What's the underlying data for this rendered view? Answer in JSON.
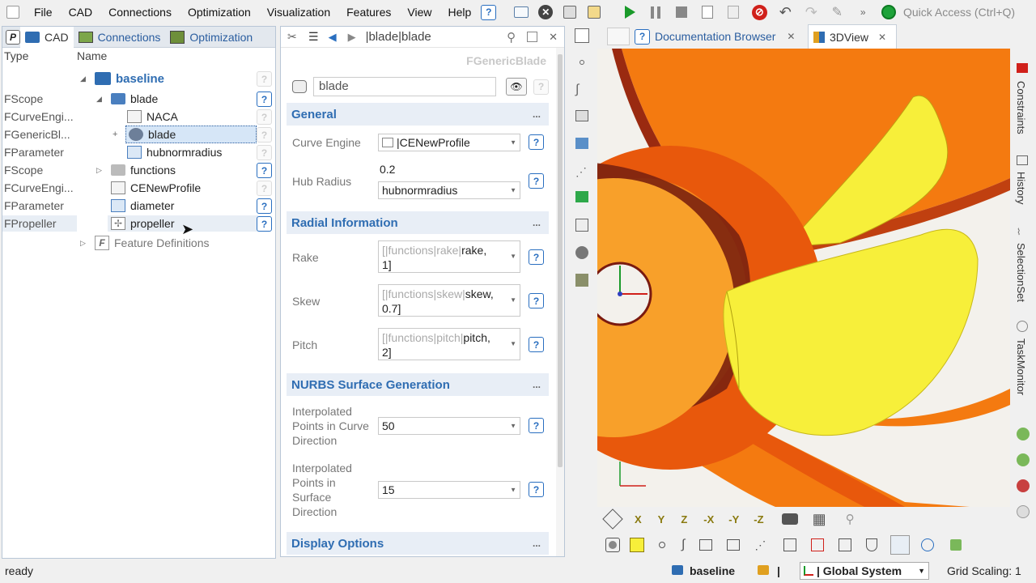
{
  "menubar": {
    "items": [
      "File",
      "CAD",
      "Connections",
      "Optimization",
      "Visualization",
      "Features",
      "View",
      "Help"
    ],
    "quick_access": "Quick Access (Ctrl+Q)"
  },
  "left_panel": {
    "tabs": {
      "p": "P",
      "cad": "CAD",
      "connections": "Connections",
      "optimization": "Optimization"
    },
    "col_type": "Type",
    "col_name": "Name",
    "tree": [
      {
        "type": "",
        "name": "baseline"
      },
      {
        "type": "FScope",
        "name": "blade"
      },
      {
        "type": "FCurveEngi...",
        "name": "NACA"
      },
      {
        "type": "FGenericBl...",
        "name": "blade"
      },
      {
        "type": "FParameter",
        "name": "hubnormradius"
      },
      {
        "type": "FScope",
        "name": "functions"
      },
      {
        "type": "FCurveEngi...",
        "name": "CENewProfile"
      },
      {
        "type": "FParameter",
        "name": "diameter"
      },
      {
        "type": "FPropeller",
        "name": "propeller"
      },
      {
        "type": "",
        "name": "Feature Definitions"
      }
    ],
    "feature_icon": "F"
  },
  "middle_panel": {
    "breadcrumb": "|blade|blade",
    "class_name": "FGenericBlade",
    "object_name": "blade",
    "sections": {
      "general": "General",
      "radial": "Radial Information",
      "nurbs": "NURBS Surface Generation",
      "display": "Display Options"
    },
    "more": "...",
    "fields": {
      "curve_engine": {
        "label": "Curve Engine",
        "value": "|CENewProfile"
      },
      "hub_radius": {
        "label": "Hub Radius",
        "value_text": "0.2",
        "value": "hubnormradius"
      },
      "rake": {
        "label": "Rake",
        "prefix": "[|functions|rake|",
        "name": "rake,",
        "line2": "1]"
      },
      "skew": {
        "label": "Skew",
        "prefix": "[|functions|skew|",
        "name": "skew,",
        "line2": "0.7]"
      },
      "pitch": {
        "label": "Pitch",
        "prefix": "[|functions|pitch|",
        "name": "pitch,",
        "line2": "2]"
      },
      "interp_curve": {
        "label_lines": [
          "Interpolated",
          "Points in Curve",
          "Direction"
        ],
        "value": "50"
      },
      "interp_surface": {
        "label_lines": [
          "Interpolated",
          "Points in",
          "Surface",
          "Direction"
        ],
        "value": "15"
      }
    }
  },
  "right_area": {
    "tabs": {
      "doc": "Documentation Browser",
      "view": "3DView"
    },
    "side_tabs": [
      "Constraints",
      "History",
      "SelectionSet",
      "TaskMonitor"
    ],
    "axis_buttons": [
      "X",
      "Y",
      "Z",
      "-X",
      "-Y",
      "-Z"
    ]
  },
  "statusbar": {
    "status": "ready",
    "scope": "baseline",
    "sep": "|",
    "coord_system": "| Global System",
    "grid_scaling": "Grid Scaling: 1"
  },
  "colors": {
    "accent": "#2f6db2",
    "orange_dark": "#e8580c",
    "orange": "#f47a10",
    "yellow": "#f7ef3a",
    "play_green": "#1a9a2a"
  }
}
